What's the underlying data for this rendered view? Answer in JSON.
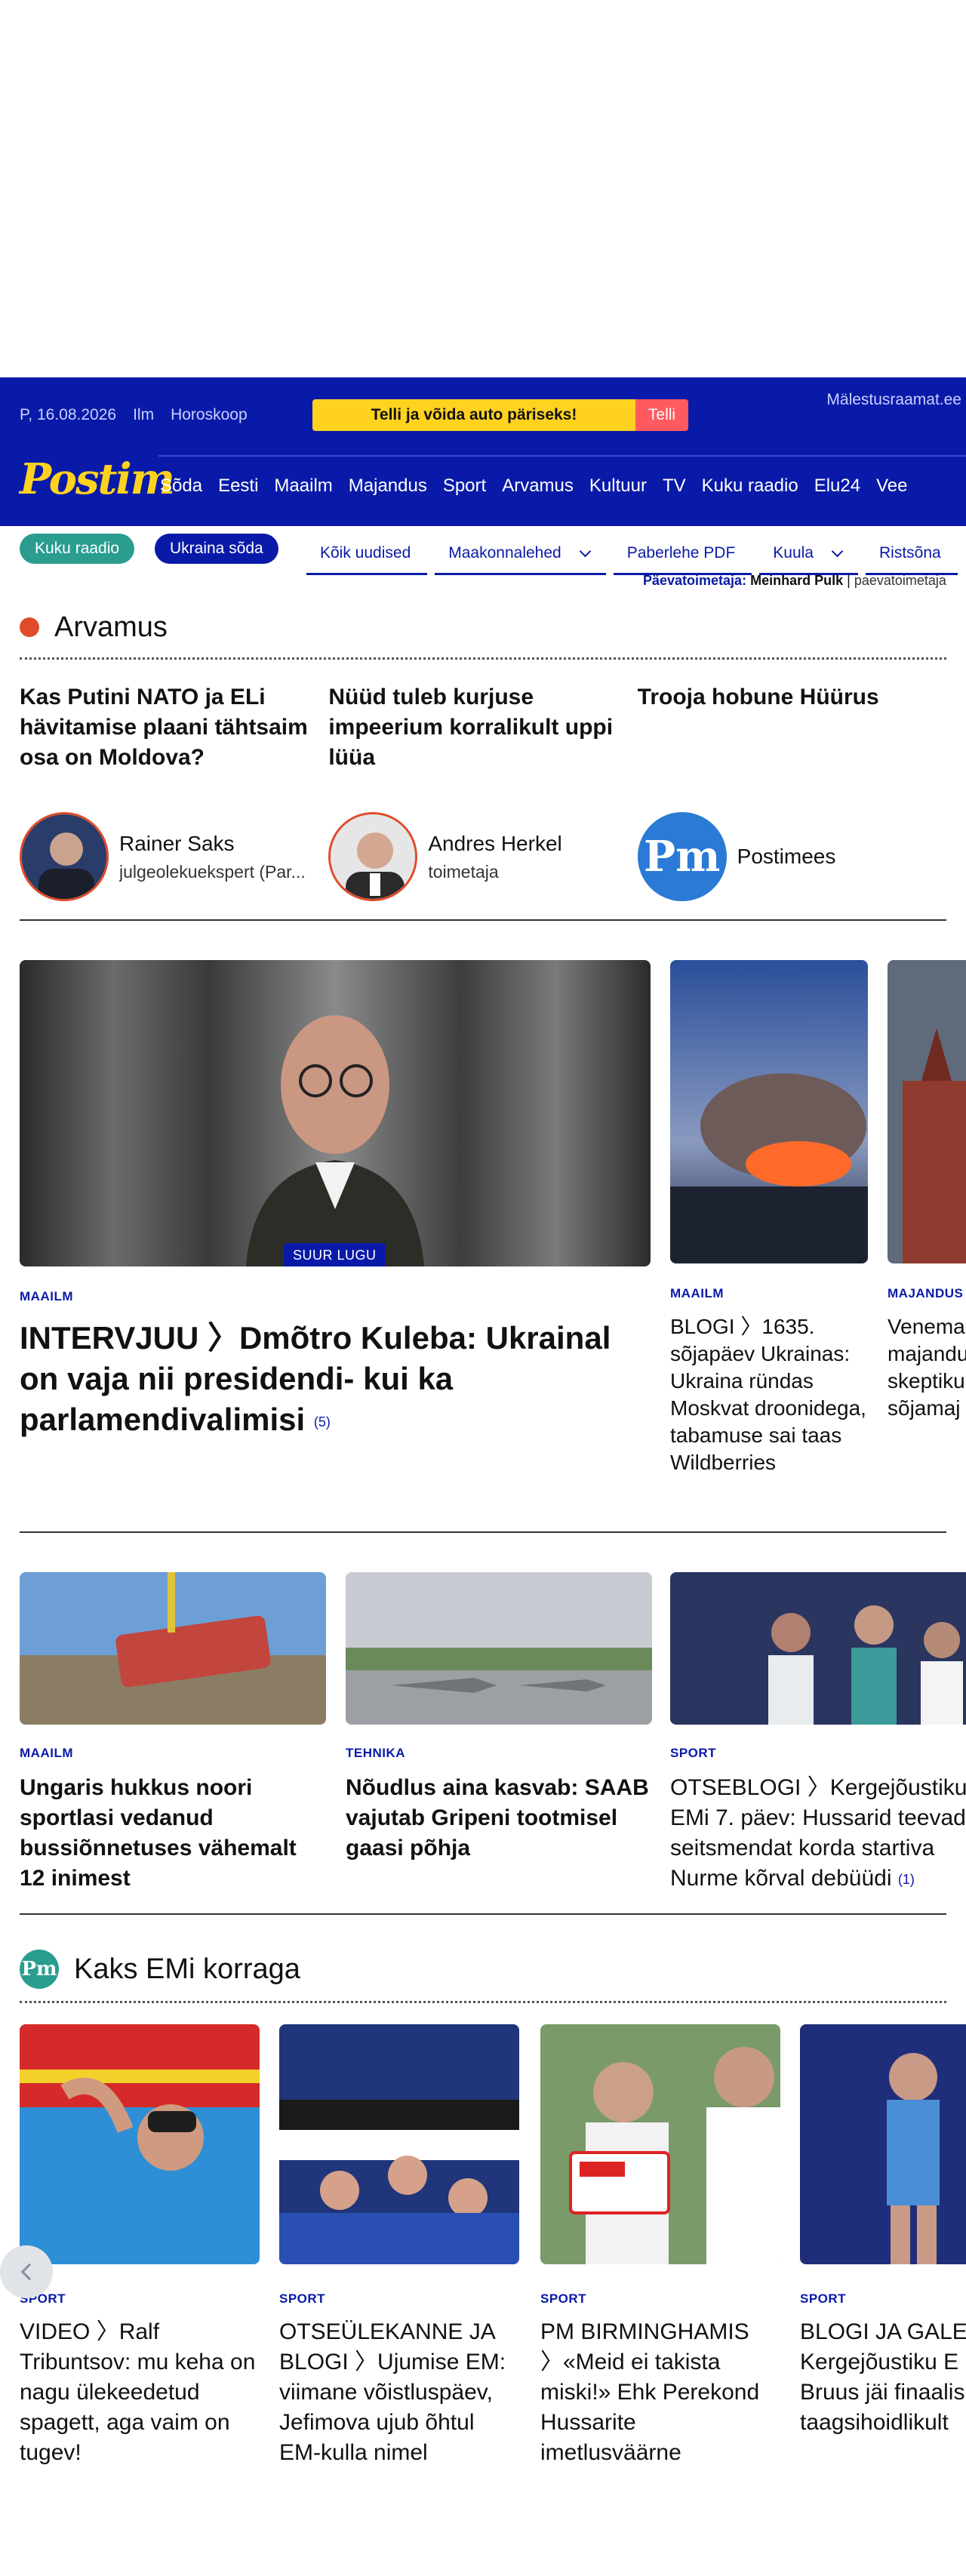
{
  "header": {
    "date": "P, 16.08.2026",
    "links": [
      "Ilm",
      "Horoskoop"
    ],
    "promo_text": "Telli ja võida auto päriseks!",
    "promo_button": "Telli",
    "right_link": "Mälestusraamat.ee",
    "logo": "Postim",
    "nav": [
      "Sõda",
      "Eesti",
      "Maailm",
      "Majandus",
      "Sport",
      "Arvamus",
      "Kultuur",
      "TV",
      "Kuku raadio",
      "Elu24",
      "Vee"
    ]
  },
  "subbar": {
    "pills": [
      "Kuku raadio",
      "Ukraina sõda"
    ],
    "nav": [
      {
        "label": "Kõik uudised",
        "dropdown": false
      },
      {
        "label": "Maakonnalehed",
        "dropdown": true
      },
      {
        "label": "Paberlehe PDF",
        "dropdown": false
      },
      {
        "label": "Kuula",
        "dropdown": true
      },
      {
        "label": "Ristsõna",
        "dropdown": false
      }
    ],
    "editor_label": "Päevatoimetaja:",
    "editor_name": "Meinhard Pulk",
    "editor_email": "paevatoimetaja"
  },
  "arvamus": {
    "title": "Arvamus",
    "items": [
      {
        "title": "Kas Putini NATO ja ELi hävitamise plaani tähtsaim osa on Moldova?",
        "author": "Rainer Saks",
        "role": "julgeolekuekspert (Par..."
      },
      {
        "title": "Nüüd tuleb kurjuse impeerium korralikult uppi lüüa",
        "author": "Andres Herkel",
        "role": "toimetaja"
      },
      {
        "title": "Trooja hobune Hüürus",
        "author": "Postimees",
        "role": ""
      }
    ],
    "pm_logo": "Pm"
  },
  "lead": {
    "badge": "SUUR LUGU",
    "category": "MAAILM",
    "title": "INTERVJUU 〉Dmõtro Kuleba: Ukrainal on vaja nii presidendi- kui ka parlamendivalimisi",
    "count": "(5)",
    "side": [
      {
        "category": "MAAILM",
        "title": "BLOGI 〉1635. sõjapäev Ukrainas: Ukraina ründas Moskvat droonidega, tabamuse sai taas Wildberries"
      },
      {
        "category": "MAJANDUS",
        "title": "Venema majandu skeptiku sõjamaj praod s"
      }
    ]
  },
  "row3": [
    {
      "category": "MAAILM",
      "title": "Ungaris hukkus noori sportlasi vedanud bussiõnnetuses vähemalt 12 inimest",
      "count": ""
    },
    {
      "category": "TEHNIKA",
      "title": "Nõudlus aina kasvab: SAAB vajutab Gripeni tootmisel gaasi põhja",
      "count": ""
    },
    {
      "category": "SPORT",
      "title": "OTSEBLOGI 〉Kergejõustiku EMi 7. päev: Hussarid teevad seitsmendat korda startiva Nurme kõrval debüüdi",
      "count": "(1)"
    }
  ],
  "ems": {
    "logo": "Pm",
    "title": "Kaks EMi korraga",
    "items": [
      {
        "category": "SPORT",
        "title": "VIDEO 〉Ralf Tribuntsov: mu keha on nagu ülekeedetud spagett, aga vaim on tugev!"
      },
      {
        "category": "SPORT",
        "title": "OTSEÜLEKANNE JA BLOGI 〉Ujumise EM: viimane võistluspäev, Jefimova ujub õhtul EM-kulla nimel"
      },
      {
        "category": "SPORT",
        "title": "PM BIRMINGHAMIS 〉«Meid ei takista miski!» Ehk Perekond Hussarite imetlusväärne"
      },
      {
        "category": "SPORT",
        "title": "BLOGI JA GALE Kergejõustiku E päev: Bruus jäi finaalis taagsihoidlikult"
      }
    ]
  },
  "colors": {
    "brand": "#0a1aa8",
    "accent_yellow": "#ffd21f",
    "accent_red": "#e04b2a",
    "teal": "#2a9d8f"
  }
}
